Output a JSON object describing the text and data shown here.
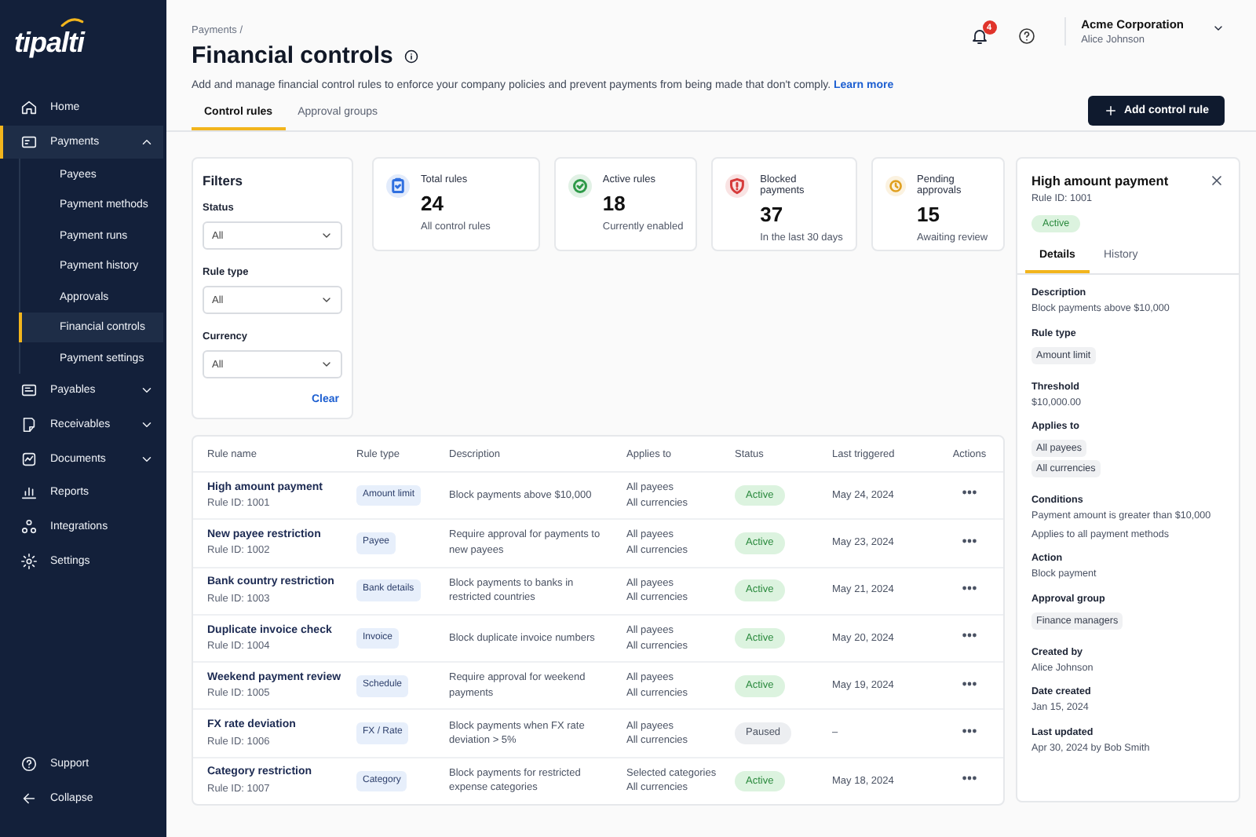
{
  "sidebar": {
    "logo": "tipalti",
    "items": [
      {
        "label": "Home",
        "kind": "link",
        "selected": false
      },
      {
        "label": "Payments",
        "kind": "group",
        "expanded": true,
        "selected": true,
        "children": [
          {
            "label": "Payees",
            "selected": false
          },
          {
            "label": "Payment methods",
            "selected": false
          },
          {
            "label": "Payment runs",
            "selected": false
          },
          {
            "label": "Payment history",
            "selected": false
          },
          {
            "label": "Approvals",
            "selected": false
          },
          {
            "label": "Financial controls",
            "selected": true
          },
          {
            "label": "Payment settings",
            "selected": false
          }
        ]
      },
      {
        "label": "Payables",
        "kind": "group",
        "expanded": false,
        "selected": false
      },
      {
        "label": "Receivables",
        "kind": "group",
        "expanded": false,
        "selected": false
      },
      {
        "label": "Documents",
        "kind": "group",
        "expanded": false,
        "selected": false
      },
      {
        "label": "Reports",
        "kind": "link",
        "selected": false
      },
      {
        "label": "Integrations",
        "kind": "link",
        "selected": false
      },
      {
        "label": "Settings",
        "kind": "link",
        "selected": false
      }
    ],
    "footer": [
      {
        "label": "Support"
      },
      {
        "label": "Collapse"
      }
    ]
  },
  "header": {
    "breadcrumb": "Payments /",
    "title": "Financial controls",
    "description": "Add and manage financial control rules to enforce your company policies and prevent payments from being made that don't comply.",
    "link": "Learn more",
    "notifications": "4",
    "company": "Acme Corporation",
    "user": "Alice Johnson"
  },
  "tabs": [
    {
      "label": "Control rules",
      "selected": true
    },
    {
      "label": "Approval groups",
      "selected": false
    }
  ],
  "add_button": "Add control rule",
  "filters": {
    "title": "Filters",
    "fields": [
      {
        "label": "Status",
        "value": "All"
      },
      {
        "label": "Rule type",
        "value": "All"
      },
      {
        "label": "Currency",
        "value": "All"
      }
    ],
    "clear": "Clear"
  },
  "stats": [
    {
      "label": "Total rules",
      "value": "24",
      "caption": "All control rules",
      "color": "#2f6fe0"
    },
    {
      "label": "Active rules",
      "value": "18",
      "caption": "Currently enabled",
      "color": "#2e9a48"
    },
    {
      "label": "Blocked payments",
      "value": "37",
      "caption": "In the last 30 days",
      "color": "#d63b3b"
    },
    {
      "label": "Pending approvals",
      "value": "15",
      "caption": "Awaiting review",
      "color": "#e0a020"
    }
  ],
  "table": {
    "columns": [
      "Rule name",
      "Rule type",
      "Description",
      "Applies to",
      "Status",
      "Last triggered",
      "Actions"
    ],
    "rows": [
      {
        "name": "High amount payment",
        "rule_id": "Rule ID: 1001",
        "type": "Amount limit",
        "description": "Block payments above $10,000",
        "applies_to": [
          "All payees",
          "All currencies"
        ],
        "status": "Active",
        "active": true,
        "last_triggered": "May 24, 2024"
      },
      {
        "name": "New payee restriction",
        "rule_id": "Rule ID: 1002",
        "type": "Payee",
        "description": "Require approval for payments to new payees",
        "applies_to": [
          "All payees",
          "All currencies"
        ],
        "status": "Active",
        "active": true,
        "last_triggered": "May 23, 2024"
      },
      {
        "name": "Bank country restriction",
        "rule_id": "Rule ID: 1003",
        "type": "Bank details",
        "description": "Block payments to banks in restricted countries",
        "applies_to": [
          "All payees",
          "All currencies"
        ],
        "status": "Active",
        "active": true,
        "last_triggered": "May 21, 2024"
      },
      {
        "name": "Duplicate invoice check",
        "rule_id": "Rule ID: 1004",
        "type": "Invoice",
        "description": "Block duplicate invoice numbers",
        "applies_to": [
          "All payees",
          "All currencies"
        ],
        "status": "Active",
        "active": true,
        "last_triggered": "May 20, 2024"
      },
      {
        "name": "Weekend payment review",
        "rule_id": "Rule ID: 1005",
        "type": "Schedule",
        "description": "Require approval for weekend payments",
        "applies_to": [
          "All payees",
          "All currencies"
        ],
        "status": "Active",
        "active": true,
        "last_triggered": "May 19, 2024"
      },
      {
        "name": "FX rate deviation",
        "rule_id": "Rule ID: 1006",
        "type": "FX / Rate",
        "description": "Block payments when FX rate deviation > 5%",
        "applies_to": [
          "All payees",
          "All currencies"
        ],
        "status": "Paused",
        "active": false,
        "last_triggered": "–"
      },
      {
        "name": "Category restriction",
        "rule_id": "Rule ID: 1007",
        "type": "Category",
        "description": "Block payments for restricted expense categories",
        "applies_to": [
          "Selected categories",
          "All currencies"
        ],
        "status": "Active",
        "active": true,
        "last_triggered": "May 18, 2024"
      }
    ]
  },
  "detail": {
    "title": "High amount payment",
    "rule_id": "Rule ID: 1001",
    "status": "Active",
    "active": true,
    "tabs": [
      {
        "label": "Details",
        "selected": true
      },
      {
        "label": "History",
        "selected": false
      }
    ],
    "sections": [
      {
        "label": "Description",
        "kind": "text",
        "values": [
          "Block payments above $10,000"
        ]
      },
      {
        "label": "Rule type",
        "kind": "tags",
        "values": [
          "Amount limit"
        ]
      },
      {
        "label": "Threshold",
        "kind": "text",
        "values": [
          "$10,000.00"
        ]
      },
      {
        "label": "Applies to",
        "kind": "tags",
        "values": [
          "All payees",
          "All currencies"
        ]
      },
      {
        "label": "Conditions",
        "kind": "text",
        "values": [
          "Payment amount is greater than $10,000",
          "Applies to all payment methods"
        ]
      },
      {
        "label": "Action",
        "kind": "text",
        "values": [
          "Block payment"
        ]
      },
      {
        "label": "Approval group",
        "kind": "tags",
        "values": [
          "Finance managers"
        ]
      },
      {
        "label": "Created by",
        "kind": "text",
        "values": [
          "Alice Johnson"
        ]
      },
      {
        "label": "Date created",
        "kind": "text",
        "values": [
          "Jan 15, 2024"
        ]
      },
      {
        "label": "Last updated",
        "kind": "text",
        "values": [
          "Apr 30, 2024 by Bob Smith"
        ]
      }
    ]
  }
}
